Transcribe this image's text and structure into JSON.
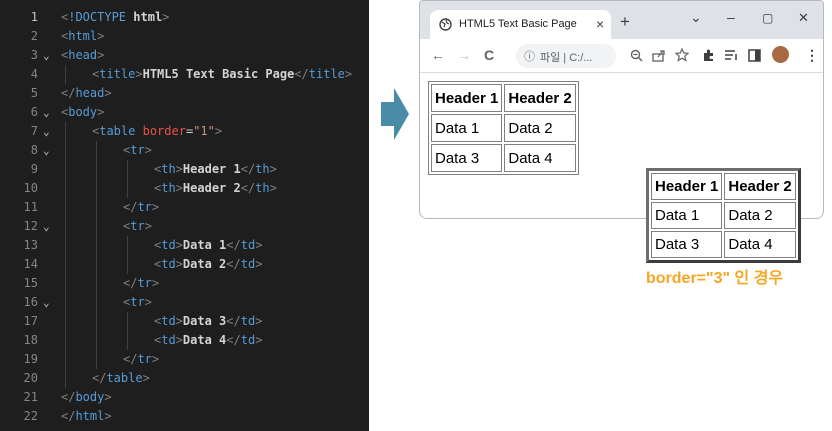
{
  "editor": {
    "lines": [
      {
        "num": "1",
        "fold": "",
        "indent": 0,
        "tokens": [
          [
            "t-bracket",
            "<"
          ],
          [
            "t-tag",
            "!DOCTYPE "
          ],
          [
            "t-text",
            "html"
          ],
          [
            "t-bracket",
            ">"
          ]
        ]
      },
      {
        "num": "2",
        "fold": "",
        "indent": 0,
        "tokens": [
          [
            "t-bracket",
            "<"
          ],
          [
            "t-tag",
            "html"
          ],
          [
            "t-bracket",
            ">"
          ]
        ]
      },
      {
        "num": "3",
        "fold": "v",
        "indent": 0,
        "tokens": [
          [
            "t-bracket",
            "<"
          ],
          [
            "t-tag",
            "head"
          ],
          [
            "t-bracket",
            ">"
          ]
        ]
      },
      {
        "num": "4",
        "fold": "",
        "indent": 1,
        "tokens": [
          [
            "t-bracket",
            "<"
          ],
          [
            "t-tag",
            "title"
          ],
          [
            "t-bracket",
            ">"
          ],
          [
            "t-text",
            "HTML5 Text Basic Page"
          ],
          [
            "t-bracket",
            "</"
          ],
          [
            "t-tag",
            "title"
          ],
          [
            "t-bracket",
            ">"
          ]
        ]
      },
      {
        "num": "5",
        "fold": "",
        "indent": 0,
        "tokens": [
          [
            "t-bracket",
            "</"
          ],
          [
            "t-tag",
            "head"
          ],
          [
            "t-bracket",
            ">"
          ]
        ]
      },
      {
        "num": "6",
        "fold": "v",
        "indent": 0,
        "tokens": [
          [
            "t-bracket",
            "<"
          ],
          [
            "t-tag",
            "body"
          ],
          [
            "t-bracket",
            ">"
          ]
        ]
      },
      {
        "num": "7",
        "fold": "v",
        "indent": 1,
        "tokens": [
          [
            "t-bracket",
            "<"
          ],
          [
            "t-tag",
            "table "
          ],
          [
            "t-attr",
            "border"
          ],
          [
            "t-eq",
            "="
          ],
          [
            "t-str",
            "\"1\""
          ],
          [
            "t-bracket",
            ">"
          ]
        ]
      },
      {
        "num": "8",
        "fold": "v",
        "indent": 2,
        "tokens": [
          [
            "t-bracket",
            "<"
          ],
          [
            "t-tag",
            "tr"
          ],
          [
            "t-bracket",
            ">"
          ]
        ]
      },
      {
        "num": "9",
        "fold": "",
        "indent": 3,
        "tokens": [
          [
            "t-bracket",
            "<"
          ],
          [
            "t-tag",
            "th"
          ],
          [
            "t-bracket",
            ">"
          ],
          [
            "t-text",
            "Header 1"
          ],
          [
            "t-bracket",
            "</"
          ],
          [
            "t-tag",
            "th"
          ],
          [
            "t-bracket",
            ">"
          ]
        ]
      },
      {
        "num": "10",
        "fold": "",
        "indent": 3,
        "tokens": [
          [
            "t-bracket",
            "<"
          ],
          [
            "t-tag",
            "th"
          ],
          [
            "t-bracket",
            ">"
          ],
          [
            "t-text",
            "Header 2"
          ],
          [
            "t-bracket",
            "</"
          ],
          [
            "t-tag",
            "th"
          ],
          [
            "t-bracket",
            ">"
          ]
        ]
      },
      {
        "num": "11",
        "fold": "",
        "indent": 2,
        "tokens": [
          [
            "t-bracket",
            "</"
          ],
          [
            "t-tag",
            "tr"
          ],
          [
            "t-bracket",
            ">"
          ]
        ]
      },
      {
        "num": "12",
        "fold": "v",
        "indent": 2,
        "tokens": [
          [
            "t-bracket",
            "<"
          ],
          [
            "t-tag",
            "tr"
          ],
          [
            "t-bracket",
            ">"
          ]
        ]
      },
      {
        "num": "13",
        "fold": "",
        "indent": 3,
        "tokens": [
          [
            "t-bracket",
            "<"
          ],
          [
            "t-tag",
            "td"
          ],
          [
            "t-bracket",
            ">"
          ],
          [
            "t-text",
            "Data 1"
          ],
          [
            "t-bracket",
            "</"
          ],
          [
            "t-tag",
            "td"
          ],
          [
            "t-bracket",
            ">"
          ]
        ]
      },
      {
        "num": "14",
        "fold": "",
        "indent": 3,
        "tokens": [
          [
            "t-bracket",
            "<"
          ],
          [
            "t-tag",
            "td"
          ],
          [
            "t-bracket",
            ">"
          ],
          [
            "t-text",
            "Data 2"
          ],
          [
            "t-bracket",
            "</"
          ],
          [
            "t-tag",
            "td"
          ],
          [
            "t-bracket",
            ">"
          ]
        ]
      },
      {
        "num": "15",
        "fold": "",
        "indent": 2,
        "tokens": [
          [
            "t-bracket",
            "</"
          ],
          [
            "t-tag",
            "tr"
          ],
          [
            "t-bracket",
            ">"
          ]
        ]
      },
      {
        "num": "16",
        "fold": "v",
        "indent": 2,
        "tokens": [
          [
            "t-bracket",
            "<"
          ],
          [
            "t-tag",
            "tr"
          ],
          [
            "t-bracket",
            ">"
          ]
        ]
      },
      {
        "num": "17",
        "fold": "",
        "indent": 3,
        "tokens": [
          [
            "t-bracket",
            "<"
          ],
          [
            "t-tag",
            "td"
          ],
          [
            "t-bracket",
            ">"
          ],
          [
            "t-text",
            "Data 3"
          ],
          [
            "t-bracket",
            "</"
          ],
          [
            "t-tag",
            "td"
          ],
          [
            "t-bracket",
            ">"
          ]
        ]
      },
      {
        "num": "18",
        "fold": "",
        "indent": 3,
        "tokens": [
          [
            "t-bracket",
            "<"
          ],
          [
            "t-tag",
            "td"
          ],
          [
            "t-bracket",
            ">"
          ],
          [
            "t-text",
            "Data 4"
          ],
          [
            "t-bracket",
            "</"
          ],
          [
            "t-tag",
            "td"
          ],
          [
            "t-bracket",
            ">"
          ]
        ]
      },
      {
        "num": "19",
        "fold": "",
        "indent": 2,
        "tokens": [
          [
            "t-bracket",
            "</"
          ],
          [
            "t-tag",
            "tr"
          ],
          [
            "t-bracket",
            ">"
          ]
        ]
      },
      {
        "num": "20",
        "fold": "",
        "indent": 1,
        "tokens": [
          [
            "t-bracket",
            "</"
          ],
          [
            "t-tag",
            "table"
          ],
          [
            "t-bracket",
            ">"
          ]
        ]
      },
      {
        "num": "21",
        "fold": "",
        "indent": 0,
        "tokens": [
          [
            "t-bracket",
            "</"
          ],
          [
            "t-tag",
            "body"
          ],
          [
            "t-bracket",
            ">"
          ]
        ]
      },
      {
        "num": "22",
        "fold": "",
        "indent": 0,
        "tokens": [
          [
            "t-bracket",
            "</"
          ],
          [
            "t-tag",
            "html"
          ],
          [
            "t-bracket",
            ">"
          ]
        ]
      }
    ],
    "token_colors": {
      "t-bracket": "#808080",
      "t-tag": "#569cd6",
      "t-attr": "#e5534b",
      "t-str": "#ce9178",
      "t-text": "#d4d4d4",
      "t-eq": "#d4d4d4"
    }
  },
  "arrow": {
    "color": "#4a8ca8",
    "icon": "arrow-right-icon"
  },
  "browser": {
    "tab_title": "HTML5 Text Basic Page",
    "tab_close": "×",
    "new_tab": "+",
    "window_minimize": "–",
    "window_restore": "▢",
    "window_close": "✕",
    "tabs_menu": "⌄",
    "nav_back": "←",
    "nav_forward": "→",
    "nav_reload": "C",
    "address_info": "ⓘ",
    "address_text": "파일 | C:/...",
    "toolbar_menu": "⋮",
    "page_table": {
      "headers": [
        "Header 1",
        "Header 2"
      ],
      "rows": [
        [
          "Data 1",
          "Data 2"
        ],
        [
          "Data 3",
          "Data 4"
        ]
      ]
    }
  },
  "border3_example": {
    "headers": [
      "Header 1",
      "Header 2"
    ],
    "rows": [
      [
        "Data 1",
        "Data 2"
      ],
      [
        "Data 3",
        "Data 4"
      ]
    ],
    "caption": "border=\"3\" 인 경우",
    "caption_color": "#f5a623"
  }
}
